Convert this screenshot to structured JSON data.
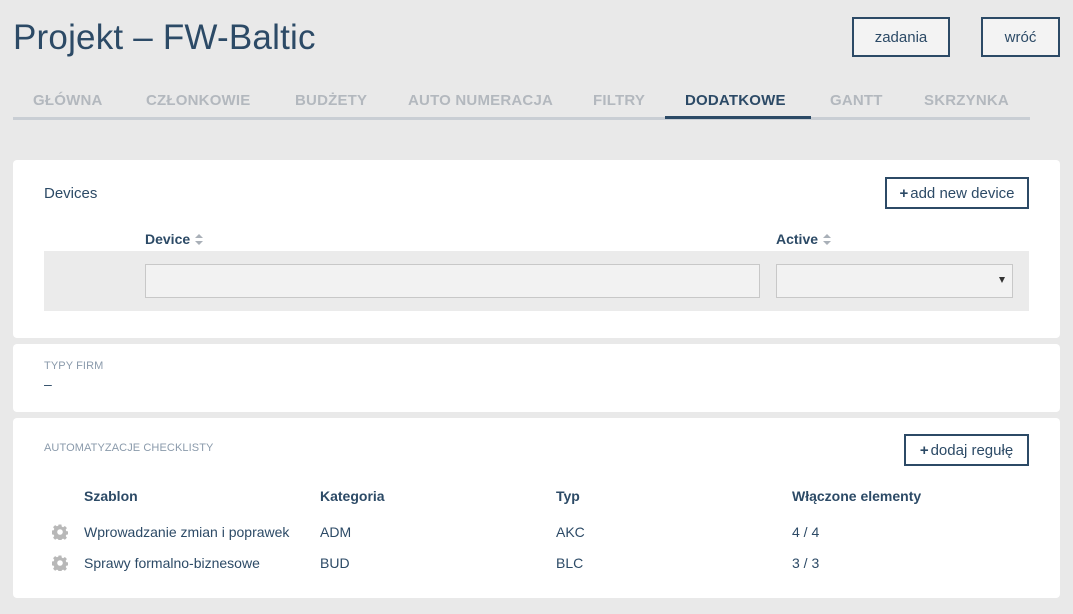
{
  "header": {
    "title": "Projekt – FW-Baltic",
    "zadania_label": "zadania",
    "wroc_label": "wróć"
  },
  "tabs": [
    {
      "label": "GŁÓWNA",
      "active": false
    },
    {
      "label": "CZŁONKOWIE",
      "active": false
    },
    {
      "label": "BUDŻETY",
      "active": false
    },
    {
      "label": "AUTO NUMERACJA",
      "active": false
    },
    {
      "label": "FILTRY",
      "active": false
    },
    {
      "label": "DODATKOWE",
      "active": true
    },
    {
      "label": "GANTT",
      "active": false
    },
    {
      "label": "SKRZYNKA",
      "active": false
    }
  ],
  "devices": {
    "title": "Devices",
    "add_button": "add new device",
    "columns": {
      "device": "Device",
      "active": "Active"
    },
    "device_filter_value": "",
    "active_filter_value": ""
  },
  "typy_firm": {
    "label": "TYPY FIRM",
    "value": "–"
  },
  "automatyzacje": {
    "label": "AUTOMATYZACJE CHECKLISTY",
    "add_button": "dodaj regułę",
    "columns": {
      "szablon": "Szablon",
      "kategoria": "Kategoria",
      "typ": "Typ",
      "wlaczone": "Włączone elementy"
    },
    "rows": [
      {
        "szablon": "Wprowadzanie zmian i poprawek",
        "kategoria": "ADM",
        "typ": "AKC",
        "wlaczone": "4 / 4"
      },
      {
        "szablon": "Sprawy formalno-biznesowe",
        "kategoria": "BUD",
        "typ": "BLC",
        "wlaczone": "3 / 3"
      }
    ]
  },
  "colors": {
    "primary": "#2c4a66",
    "tab_inactive": "#b3b8be",
    "background": "#e9e9e9"
  },
  "icons": {
    "plus": "plus-icon",
    "sort": "sort-icon",
    "gear": "gear-icon",
    "caret": "caret-down-icon"
  }
}
